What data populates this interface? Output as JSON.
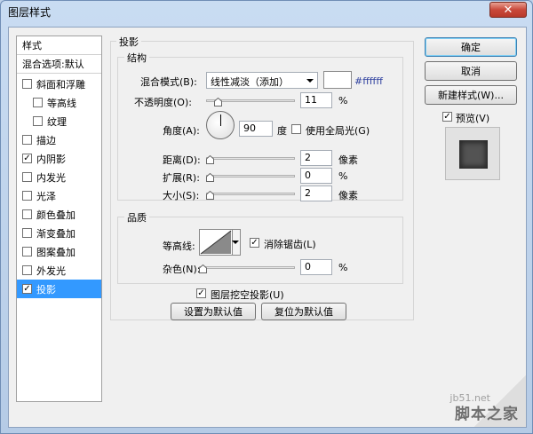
{
  "window": {
    "title": "图层样式",
    "close_glyph": "✕"
  },
  "styles_panel": {
    "header": "样式",
    "blend_options": "混合选项:默认",
    "items": [
      {
        "label": "斜面和浮雕",
        "checked": false,
        "indent": false
      },
      {
        "label": "等高线",
        "checked": false,
        "indent": true
      },
      {
        "label": "纹理",
        "checked": false,
        "indent": true
      },
      {
        "label": "描边",
        "checked": false,
        "indent": false
      },
      {
        "label": "内阴影",
        "checked": true,
        "indent": false
      },
      {
        "label": "内发光",
        "checked": false,
        "indent": false
      },
      {
        "label": "光泽",
        "checked": false,
        "indent": false
      },
      {
        "label": "颜色叠加",
        "checked": false,
        "indent": false
      },
      {
        "label": "渐变叠加",
        "checked": false,
        "indent": false
      },
      {
        "label": "图案叠加",
        "checked": false,
        "indent": false
      },
      {
        "label": "外发光",
        "checked": false,
        "indent": false
      },
      {
        "label": "投影",
        "checked": true,
        "indent": false,
        "selected": true
      }
    ]
  },
  "drop_shadow": {
    "section_title": "投影",
    "structure": {
      "title": "结构",
      "blend_mode_label": "混合模式(B):",
      "blend_mode_value": "线性减淡（添加）",
      "color_hex": "#ffffff",
      "opacity_label": "不透明度(O):",
      "opacity_value": "11",
      "opacity_unit": "%",
      "opacity_slider": 0.11,
      "angle_label": "角度(A):",
      "angle_value": "90",
      "angle_unit": "度",
      "global_light_label": "使用全局光(G)",
      "global_light_checked": false,
      "distance_label": "距离(D):",
      "distance_value": "2",
      "distance_unit": "像素",
      "spread_label": "扩展(R):",
      "spread_value": "0",
      "spread_unit": "%",
      "size_label": "大小(S):",
      "size_value": "2",
      "size_unit": "像素"
    },
    "quality": {
      "title": "品质",
      "contour_label": "等高线:",
      "antialias_label": "消除锯齿(L)",
      "antialias_checked": true,
      "noise_label": "杂色(N):",
      "noise_value": "0",
      "noise_unit": "%"
    },
    "knockout_label": "图层挖空投影(U)",
    "knockout_checked": true,
    "set_default": "设置为默认值",
    "reset_default": "复位为默认值"
  },
  "buttons": {
    "ok": "确定",
    "cancel": "取消",
    "new_style": "新建样式(W)...",
    "preview_label": "预览(V)",
    "preview_checked": true
  },
  "watermark": {
    "site": "jb51.net",
    "brand": "脚本之家"
  },
  "colors": {
    "selection": "#3399ff",
    "hex_text": "#2d3f9e",
    "preview_swatch": "#535353"
  }
}
